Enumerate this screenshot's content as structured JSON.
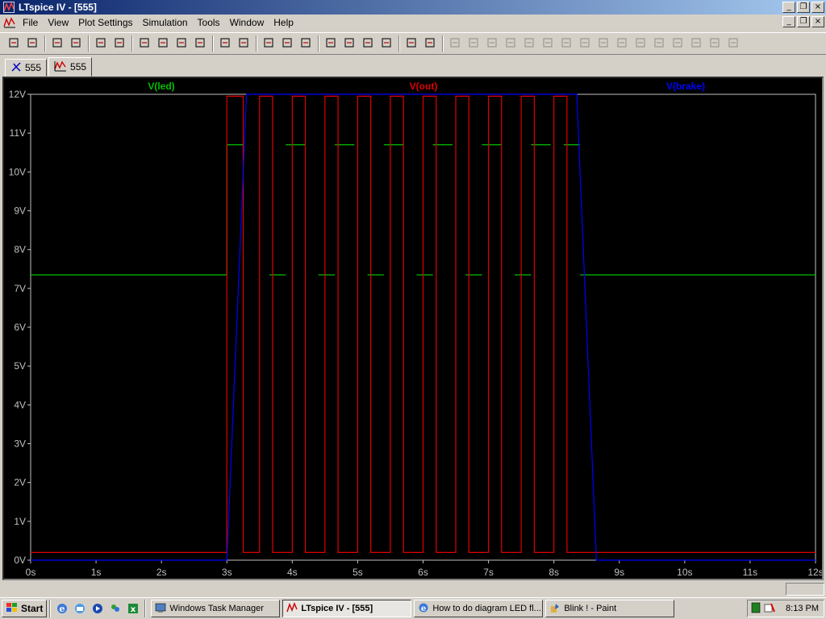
{
  "window": {
    "title": "LTspice IV - [555]"
  },
  "menu": [
    "File",
    "View",
    "Plot Settings",
    "Simulation",
    "Tools",
    "Window",
    "Help"
  ],
  "tabs": [
    {
      "label": "555",
      "icon": "schematic-icon"
    },
    {
      "label": "555",
      "icon": "waveform-icon"
    }
  ],
  "toolbar_icons": [
    "new-schematic-icon",
    "open-icon",
    "save-icon",
    "control-panel-icon",
    "run-icon",
    "halt-icon",
    "zoom-in-icon",
    "zoom-area-icon",
    "zoom-out-icon",
    "cancel-zoom-icon",
    "autorange-icon",
    "fit-icon",
    "tile-horizontal-icon",
    "cascade-icon",
    "tile-vertical-icon",
    "cut-icon",
    "copy-icon",
    "paste-icon",
    "find-icon",
    "print-setup-icon",
    "print-icon",
    "wire-icon",
    "ground-icon",
    "label-icon",
    "resistor-icon",
    "capacitor-icon",
    "inductor-icon",
    "diode-icon",
    "component-icon",
    "move-icon",
    "drag-icon",
    "undo-icon",
    "redo-icon",
    "rotate-icon",
    "mirror-icon",
    "text-icon",
    "spice-directive-icon"
  ],
  "chart_data": {
    "type": "line",
    "title": "",
    "xlabel": "",
    "ylabel": "",
    "xlim": [
      0,
      12
    ],
    "ylim": [
      0,
      12
    ],
    "x_ticks": [
      "0s",
      "1s",
      "2s",
      "3s",
      "4s",
      "5s",
      "6s",
      "7s",
      "8s",
      "9s",
      "10s",
      "11s",
      "12s"
    ],
    "y_ticks": [
      "0V",
      "1V",
      "2V",
      "3V",
      "4V",
      "5V",
      "6V",
      "7V",
      "8V",
      "9V",
      "10V",
      "11V",
      "12V"
    ],
    "legend_placement": "top",
    "series": [
      {
        "name": "V(led)",
        "color": "#00c000",
        "x": [
          0,
          3.0,
          3.0,
          3.5,
          3.5,
          4.5,
          4.5,
          5.5,
          5.5,
          6.5,
          6.5,
          7.5,
          7.5,
          8.4,
          8.4,
          12
        ],
        "y": [
          7.35,
          7.35,
          10.7,
          10.7,
          7.35,
          7.35,
          10.7,
          10.7,
          7.35,
          7.35,
          10.7,
          10.7,
          7.35,
          7.35,
          7.35,
          7.35
        ],
        "segments": [
          {
            "x": [
              0,
              3.0
            ],
            "y": [
              7.35,
              7.35
            ]
          },
          {
            "x": [
              3.0,
              3.0
            ],
            "y": [
              7.35,
              10.7
            ]
          },
          {
            "x": [
              3.0,
              3.25
            ],
            "y": [
              10.7,
              10.7
            ]
          },
          {
            "x": [
              3.65,
              3.9
            ],
            "y": [
              7.35,
              7.35
            ]
          },
          {
            "x": [
              3.9,
              4.2
            ],
            "y": [
              10.7,
              10.7
            ]
          },
          {
            "x": [
              4.4,
              4.65
            ],
            "y": [
              7.35,
              7.35
            ]
          },
          {
            "x": [
              4.65,
              4.95
            ],
            "y": [
              10.7,
              10.7
            ]
          },
          {
            "x": [
              5.15,
              5.4
            ],
            "y": [
              7.35,
              7.35
            ]
          },
          {
            "x": [
              5.4,
              5.7
            ],
            "y": [
              10.7,
              10.7
            ]
          },
          {
            "x": [
              5.9,
              6.15
            ],
            "y": [
              7.35,
              7.35
            ]
          },
          {
            "x": [
              6.15,
              6.45
            ],
            "y": [
              10.7,
              10.7
            ]
          },
          {
            "x": [
              6.65,
              6.9
            ],
            "y": [
              7.35,
              7.35
            ]
          },
          {
            "x": [
              6.9,
              7.2
            ],
            "y": [
              10.7,
              10.7
            ]
          },
          {
            "x": [
              7.4,
              7.65
            ],
            "y": [
              7.35,
              7.35
            ]
          },
          {
            "x": [
              7.65,
              7.95
            ],
            "y": [
              10.7,
              10.7
            ]
          },
          {
            "x": [
              8.15,
              8.4
            ],
            "y": [
              10.7,
              10.7
            ]
          },
          {
            "x": [
              8.4,
              12
            ],
            "y": [
              7.35,
              7.35
            ]
          }
        ]
      },
      {
        "name": "V(out)",
        "color": "#e00000",
        "x": [
          0,
          3.0,
          3.0,
          3.25,
          3.25,
          3.5,
          3.5,
          3.7,
          3.7,
          4.0,
          4.0,
          4.2,
          4.2,
          4.5,
          4.5,
          4.7,
          4.7,
          5.0,
          5.0,
          5.2,
          5.2,
          5.5,
          5.5,
          5.7,
          5.7,
          6.0,
          6.0,
          6.2,
          6.2,
          6.5,
          6.5,
          6.7,
          6.7,
          7.0,
          7.0,
          7.2,
          7.2,
          7.5,
          7.5,
          7.7,
          7.7,
          8.0,
          8.0,
          8.2,
          8.2,
          8.4,
          8.4,
          12
        ],
        "y": [
          0.2,
          0.2,
          11.95,
          11.95,
          0.2,
          0.2,
          11.95,
          11.95,
          0.2,
          0.2,
          11.95,
          11.95,
          0.2,
          0.2,
          11.95,
          11.95,
          0.2,
          0.2,
          11.95,
          11.95,
          0.2,
          0.2,
          11.95,
          11.95,
          0.2,
          0.2,
          11.95,
          11.95,
          0.2,
          0.2,
          11.95,
          11.95,
          0.2,
          0.2,
          11.95,
          11.95,
          0.2,
          0.2,
          11.95,
          11.95,
          0.2,
          0.2,
          11.95,
          11.95,
          0.2,
          0.2,
          0.2,
          0.2
        ]
      },
      {
        "name": "V(brake)",
        "color": "#0000ff",
        "x": [
          0,
          3.0,
          3.3,
          8.35,
          8.65,
          12
        ],
        "y": [
          0,
          0,
          12,
          12,
          0,
          0
        ]
      }
    ]
  },
  "statusbar": {
    "pane": ""
  },
  "taskbar": {
    "start_label": "Start",
    "tasks": [
      {
        "label": "Windows Task Manager",
        "icon": "task-manager-icon",
        "active": false
      },
      {
        "label": "LTspice IV - [555]",
        "icon": "ltspice-icon",
        "active": true
      },
      {
        "label": "How to do diagram LED fl...",
        "icon": "ie-icon",
        "active": false
      },
      {
        "label": "Blink ! - Paint",
        "icon": "paint-icon",
        "active": false
      }
    ],
    "clock": "8:13 PM"
  }
}
